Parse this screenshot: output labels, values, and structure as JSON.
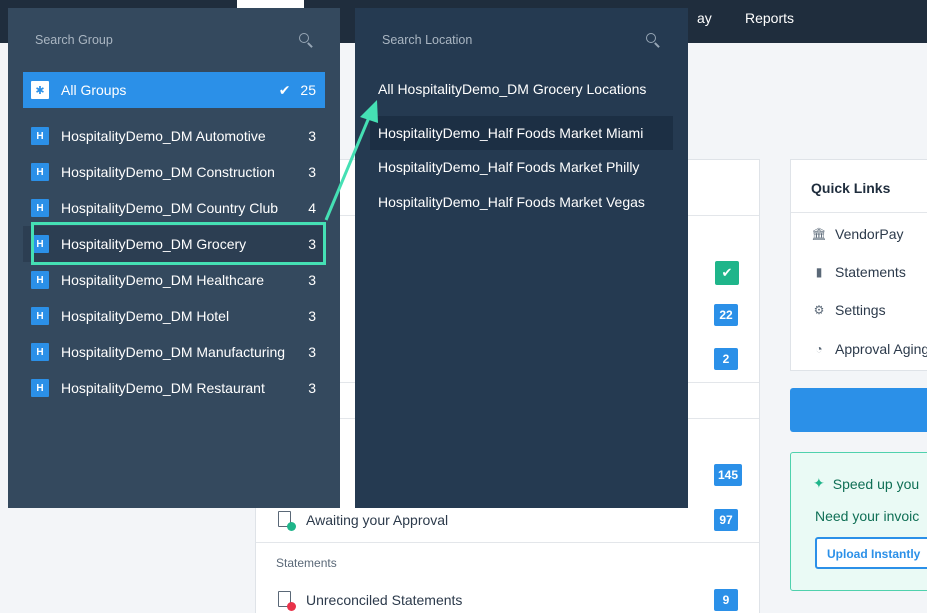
{
  "topbar": {
    "nav_partial": "ay",
    "nav_reports": "Reports"
  },
  "main_card": {
    "badges": [
      {
        "value": "22"
      },
      {
        "value": "2"
      },
      {
        "value": "145"
      },
      {
        "value": "97"
      }
    ],
    "awaiting_label": "Awaiting your Approval",
    "statements_heading": "Statements",
    "unreconciled_label": "Unreconciled Statements",
    "unreconciled_count": "9"
  },
  "quick_links": {
    "title": "Quick Links",
    "items": [
      {
        "label": "VendorPay",
        "icon": "bank-icon"
      },
      {
        "label": "Statements",
        "icon": "document-icon"
      },
      {
        "label": "Settings",
        "icon": "gear-icon"
      },
      {
        "label": "Approval Aging",
        "icon": "aging-icon"
      }
    ]
  },
  "promo": {
    "headline": "Speed up you",
    "subline": "Need your invoic",
    "button": "Upload Instantly"
  },
  "group_panel": {
    "search_placeholder": "Search Group",
    "all": {
      "badge": "✱",
      "label": "All Groups",
      "count": "25"
    },
    "items": [
      {
        "badge": "H",
        "label": "HospitalityDemo_DM Automotive",
        "count": "3"
      },
      {
        "badge": "H",
        "label": "HospitalityDemo_DM Construction",
        "count": "3"
      },
      {
        "badge": "H",
        "label": "HospitalityDemo_DM Country Club",
        "count": "4"
      },
      {
        "badge": "H",
        "label": "HospitalityDemo_DM Grocery",
        "count": "3"
      },
      {
        "badge": "H",
        "label": "HospitalityDemo_DM Healthcare",
        "count": "3"
      },
      {
        "badge": "H",
        "label": "HospitalityDemo_DM Hotel",
        "count": "3"
      },
      {
        "badge": "H",
        "label": "HospitalityDemo_DM Manufacturing",
        "count": "3"
      },
      {
        "badge": "H",
        "label": "HospitalityDemo_DM Restaurant",
        "count": "3"
      }
    ]
  },
  "location_panel": {
    "search_placeholder": "Search Location",
    "items": [
      {
        "label": "All HospitalityDemo_DM Grocery Locations"
      },
      {
        "label": "HospitalityDemo_Half Foods Market Miami"
      },
      {
        "label": "HospitalityDemo_Half Foods Market Philly"
      },
      {
        "label": "HospitalityDemo_Half Foods Market Vegas"
      }
    ]
  },
  "colors": {
    "accent": "#2b90e8",
    "annotation": "#45e0b4",
    "panel_group_bg": "#34495e",
    "panel_location_bg": "#253a51"
  }
}
